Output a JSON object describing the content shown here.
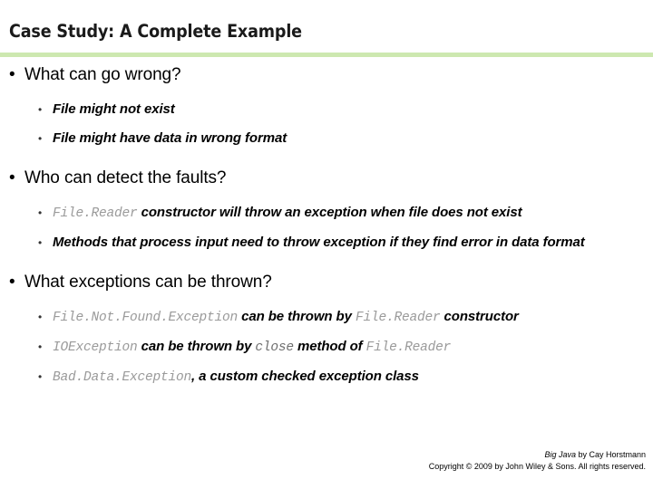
{
  "slide": {
    "title": "Case Study: A Complete Example",
    "accent_color": "#cde8b0",
    "code_color": "#9a9a9a",
    "code_color_dark": "#6f6f6f",
    "text_color": "#000000"
  },
  "bullet_glyphs": {
    "level1": "•",
    "level2": "•"
  },
  "sections": [
    {
      "heading": "What can go wrong?",
      "items": [
        {
          "parts": [
            {
              "type": "text",
              "value": "File might not exist"
            }
          ]
        },
        {
          "parts": [
            {
              "type": "text",
              "value": "File might have data in wrong format"
            }
          ]
        }
      ]
    },
    {
      "heading": "Who can detect the faults?",
      "items": [
        {
          "parts": [
            {
              "type": "code",
              "value": "File.Reader"
            },
            {
              "type": "text",
              "value": " constructor will throw an exception when file does not exist"
            }
          ]
        },
        {
          "parts": [
            {
              "type": "text",
              "value": "Methods that process input need to throw exception if they find error in data format"
            }
          ]
        }
      ]
    },
    {
      "heading": "What exceptions can be thrown?",
      "items": [
        {
          "parts": [
            {
              "type": "code",
              "value": "File.Not.Found.Exception"
            },
            {
              "type": "text",
              "value": " can be thrown by "
            },
            {
              "type": "code",
              "value": "File.Reader"
            },
            {
              "type": "text",
              "value": " constructor"
            }
          ]
        },
        {
          "parts": [
            {
              "type": "code",
              "value": "IOException"
            },
            {
              "type": "text",
              "value": " can be thrown by "
            },
            {
              "type": "code",
              "value": "close",
              "dark": true
            },
            {
              "type": "text",
              "value": " method of "
            },
            {
              "type": "code",
              "value": "File.Reader"
            }
          ]
        },
        {
          "parts": [
            {
              "type": "code",
              "value": "Bad.Data.Exception"
            },
            {
              "type": "text",
              "value": ", a custom checked exception class"
            }
          ]
        }
      ]
    }
  ],
  "footer": {
    "line1_book": "Big Java",
    "line1_rest": " by Cay Horstmann",
    "line2": "Copyright © 2009 by John Wiley & Sons.  All rights reserved."
  }
}
